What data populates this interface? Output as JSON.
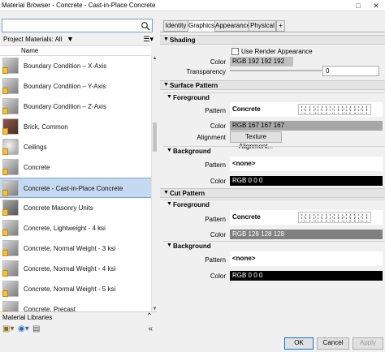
{
  "window": {
    "title": "Material Browser - Concrete - Cast-in-Place Concrete",
    "maximize_glyph": "□",
    "close_glyph": "✕"
  },
  "left": {
    "search": {
      "placeholder": "",
      "value": ""
    },
    "project_materials_label": "Project Materials: All",
    "column_header": "Name",
    "materials": [
      {
        "name": "Boundary Condition – X-Axis",
        "thumb": "grey"
      },
      {
        "name": "Boundary Condition – Y-Axis",
        "thumb": "grey"
      },
      {
        "name": "Boundary Condition – Z-Axis",
        "thumb": "grey"
      },
      {
        "name": "Brick, Common",
        "thumb": "brick"
      },
      {
        "name": "Ceilings",
        "thumb": "ceiling"
      },
      {
        "name": "Concrete",
        "thumb": "grey"
      },
      {
        "name": "Concrete - Cast-in-Place Concrete",
        "thumb": "grey",
        "selected": true
      },
      {
        "name": "Concrete Masonry Units",
        "thumb": "dark"
      },
      {
        "name": "Concrete, Lightweight - 4 ksi",
        "thumb": "grey"
      },
      {
        "name": "Concrete, Normal Weight - 3 ksi",
        "thumb": "grey"
      },
      {
        "name": "Concrete, Normal Weight - 4 ksi",
        "thumb": "grey"
      },
      {
        "name": "Concrete, Normal Weight - 5 ksi",
        "thumb": "grey"
      },
      {
        "name": "Concrete, Precast",
        "thumb": "grey"
      }
    ],
    "material_libraries_label": "Material Libraries"
  },
  "right": {
    "tabs": [
      "Identity",
      "Graphics",
      "Appearance",
      "Physical",
      "+"
    ],
    "active_tab": "Graphics",
    "shading": {
      "title": "Shading",
      "use_render_label": "Use Render Appearance",
      "color_label": "Color",
      "color_value": "RGB 192 192 192",
      "color_hex": "#c0c0c0",
      "transparency_label": "Transparency",
      "transparency_value": "0"
    },
    "surface_pattern": {
      "title": "Surface Pattern",
      "foreground": {
        "title": "Foreground",
        "pattern_label": "Pattern",
        "pattern_value": "Concrete",
        "color_label": "Color",
        "color_value": "RGB 167 167 167",
        "color_hex": "#a7a7a7",
        "alignment_label": "Alignment",
        "alignment_button": "Texture Alignment..."
      },
      "background": {
        "title": "Background",
        "pattern_label": "Pattern",
        "pattern_value": "<none>",
        "color_label": "Color",
        "color_value": "RGB 0 0 0",
        "color_hex": "#000000"
      }
    },
    "cut_pattern": {
      "title": "Cut Pattern",
      "foreground": {
        "title": "Foreground",
        "pattern_label": "Pattern",
        "pattern_value": "Concrete",
        "color_label": "Color",
        "color_value": "RGB 128 128 128",
        "color_hex": "#808080"
      },
      "background": {
        "title": "Background",
        "pattern_label": "Pattern",
        "pattern_value": "<none>",
        "color_label": "Color",
        "color_value": "RGB 0 0 0",
        "color_hex": "#000000"
      }
    },
    "buttons": {
      "ok": "OK",
      "cancel": "Cancel",
      "apply": "Apply"
    }
  }
}
